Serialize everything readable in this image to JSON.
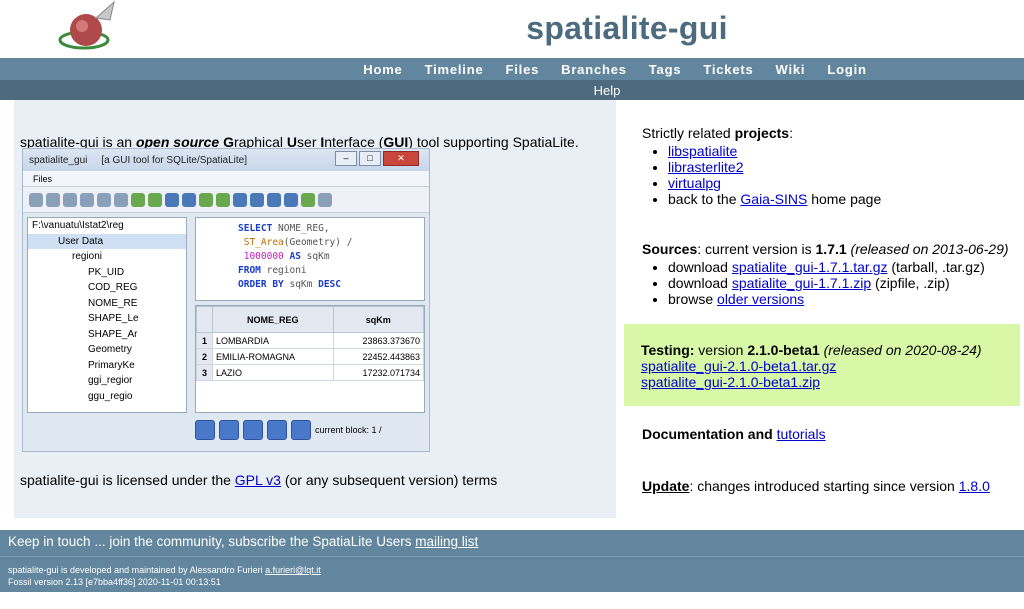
{
  "header": {
    "site_title": "spatialite-gui",
    "menu": [
      "Home",
      "Timeline",
      "Files",
      "Branches",
      "Tags",
      "Tickets",
      "Wiki",
      "Login"
    ],
    "submenu": [
      "Help"
    ]
  },
  "left": {
    "intro_prefix": "spatialite-gui is an ",
    "intro_open_source": "open source",
    "intro_g": "G",
    "intro_raphical": "raphical ",
    "intro_u": "U",
    "intro_ser": "ser ",
    "intro_i": "I",
    "intro_nterface": "nterface (",
    "intro_gui": "GUI",
    "intro_suffix": ") tool supporting SpatiaLite.",
    "license_prefix": "spatialite-gui is licensed under the ",
    "license_link": "GPL v3",
    "license_suffix": " (or any subsequent version) terms"
  },
  "screenshot": {
    "app_name": "spatialite_gui",
    "app_subtitle": "[a GUI tool for SQLite/SpatiaLite]",
    "menu_files": "Files",
    "tree": [
      "F:\\vanuatu\\Istat2\\reg",
      "User Data",
      "regioni",
      "PK_UID",
      "COD_REG",
      "NOME_RE",
      "SHAPE_Le",
      "SHAPE_Ar",
      "Geometry",
      "PrimaryKe",
      "ggi_regior",
      "ggu_regio"
    ],
    "sql": {
      "l1_kw": "SELECT",
      "l1_rest": " NOME_REG,",
      "l2_fn": "ST_Area",
      "l2_rest": "(Geometry) /",
      "l3_num": "1000000",
      "l3_kw": " AS",
      "l3_rest": " sqKm",
      "l4_kw": "FROM",
      "l4_rest": " regioni",
      "l5_kw": "ORDER BY",
      "l5_rest": " sqKm ",
      "l5_kw2": "DESC"
    },
    "grid": {
      "headers": [
        "NOME_REG",
        "sqKm"
      ],
      "rows": [
        {
          "n": "1",
          "name": "LOMBARDIA",
          "val": "23863.373670"
        },
        {
          "n": "2",
          "name": "EMILIA-ROMAGNA",
          "val": "22452.443863"
        },
        {
          "n": "3",
          "name": "LAZIO",
          "val": "17232.071734"
        }
      ]
    },
    "current_block": "current block: 1 /"
  },
  "right": {
    "related_prefix": "Strictly related ",
    "related_bold": "projects",
    "related_suffix": ":",
    "related_items": [
      "libspatialite",
      "librasterlite2",
      "virtualpg"
    ],
    "related_gaia_prefix": "back to the ",
    "related_gaia_link": "Gaia-SINS",
    "related_gaia_suffix": " home page",
    "sources_bold": "Sources",
    "sources_mid": ": current version is ",
    "sources_version": "1.7.1",
    "sources_released": " (released on 2013-06-29)",
    "dl1_prefix": "download ",
    "dl1_link": "spatialite_gui-1.7.1.tar.gz",
    "dl1_suffix": " (tarball, .tar.gz)",
    "dl2_prefix": "download ",
    "dl2_link": "spatialite_gui-1.7.1.zip",
    "dl2_suffix": " (zipfile, .zip)",
    "browse_prefix": "browse ",
    "browse_link": "older versions",
    "testing_bold": "Testing:",
    "testing_mid": " version ",
    "testing_version": "2.1.0-beta1",
    "testing_released": " (released on 2020-08-24)",
    "testing_link1": "spatialite_gui-2.1.0-beta1.tar.gz",
    "testing_link2": "spatialite_gui-2.1.0-beta1.zip",
    "doc_bold": "Documentation and ",
    "doc_link": "tutorials",
    "update_bold": "Update",
    "update_text": ": changes introduced starting since version ",
    "update_link": "1.8.0"
  },
  "footer": {
    "keep_text": "Keep in touch ... join the community, subscribe the SpatiaLite Users ",
    "keep_link": "mailing list",
    "maintained": "spatialite-gui is developed and maintained by Alessandro Furieri ",
    "email": "a.furieri@lqt.it",
    "fossil": "Fossil version 2.13 [e7bba4ff36] 2020-11-01 00:13:51"
  },
  "colors": {
    "menu_bar": "#62869e",
    "sub_bar": "#4e6b7e",
    "left_panel": "#eaeef5",
    "testing_bg": "#d8f8a8",
    "title": "#4d6b7e"
  }
}
